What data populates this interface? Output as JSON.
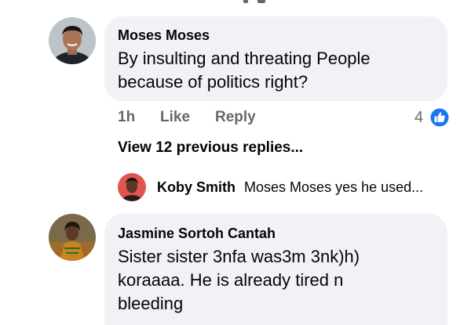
{
  "comments": [
    {
      "author": "Moses Moses",
      "lines": [
        "By insulting and threating People",
        "because of politics right?"
      ],
      "time": "1h",
      "like_label": "Like",
      "reply_label": "Reply",
      "reaction_count": "4",
      "reaction_icon": "thumbs-up-icon"
    },
    {
      "author": "Jasmine Sortoh Cantah",
      "lines": [
        "Sister sister 3nfa was3m 3nk)h)",
        "koraaaa. He is already tired n",
        "bleeding"
      ]
    }
  ],
  "thread": {
    "view_replies_label": "View 12 previous replies...",
    "reply_preview": {
      "author": "Koby Smith",
      "snippet": "Moses Moses yes he used..."
    }
  },
  "colors": {
    "bubble": "#f0f2f5",
    "secondary_text": "#65676b",
    "primary_text": "#050505",
    "like_blue": "#1877f2"
  }
}
